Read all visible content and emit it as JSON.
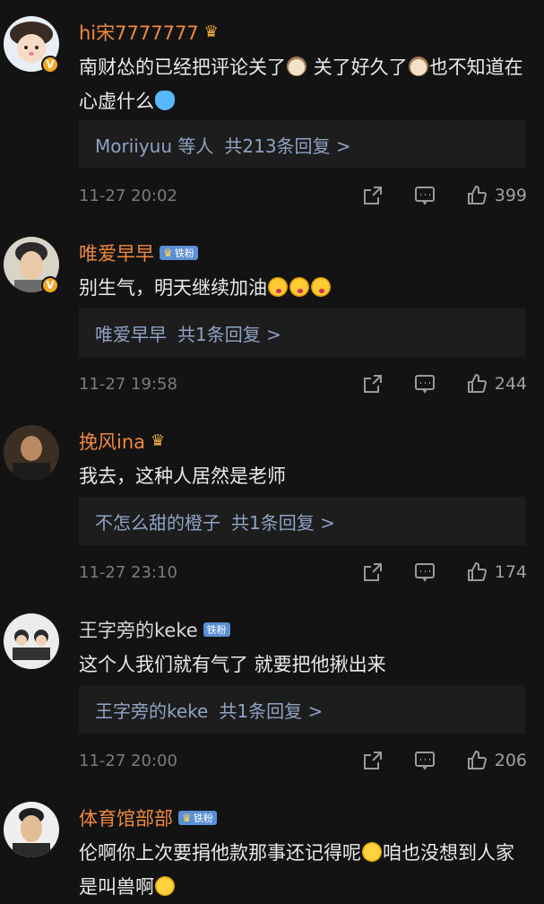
{
  "colors": {
    "background": "#131313",
    "username": "#f0883e",
    "reply_link": "#8fa2c4",
    "meta": "#7b7b7b",
    "reply_bg": "#1d1d1d"
  },
  "comments": [
    {
      "username": "hi宋7777777",
      "badge_icon": "crown-icon",
      "verified": true,
      "text_parts": [
        "南财怂的已经把评论关了",
        "关了好久了",
        "也不知道在心虚什么"
      ],
      "emoji": [
        "cat-emoji",
        "cat-emoji",
        "fish-emoji"
      ],
      "reply_user": "Moriiyuu 等人",
      "reply_count": "共213条回复 >",
      "time": "11-27 20:02",
      "likes": "399"
    },
    {
      "username": "唯爱早早",
      "fan_badge": "铁粉",
      "verified": true,
      "text_parts": [
        "别生气，明天继续加油"
      ],
      "emoji": [
        "kiss-emoji",
        "kiss-emoji",
        "kiss-emoji"
      ],
      "reply_user": "唯爱早早",
      "reply_count": "共1条回复 >",
      "time": "11-27 19:58",
      "likes": "244"
    },
    {
      "username": "挽风ina",
      "badge_icon": "crown-icon",
      "text_parts": [
        "我去，这种人居然是老师"
      ],
      "reply_user": "不怎么甜的橙子",
      "reply_count": "共1条回复 >",
      "time": "11-27 23:10",
      "likes": "174"
    },
    {
      "username": "王字旁的keke",
      "fan_badge": "铁粉",
      "text_parts": [
        "这个人我们就有气了 就要把他揪出来"
      ],
      "reply_user": "王字旁的keke",
      "reply_count": "共1条回复 >",
      "time": "11-27 20:00",
      "likes": "206"
    },
    {
      "username": "体育馆部部",
      "fan_badge": "铁粉",
      "text_parts": [
        "伦啊你上次要捐他款那事还记得呢",
        "咱也没想到人家是叫兽啊"
      ],
      "emoji": [
        "shocked-emoji",
        "shocked-emoji"
      ]
    }
  ]
}
